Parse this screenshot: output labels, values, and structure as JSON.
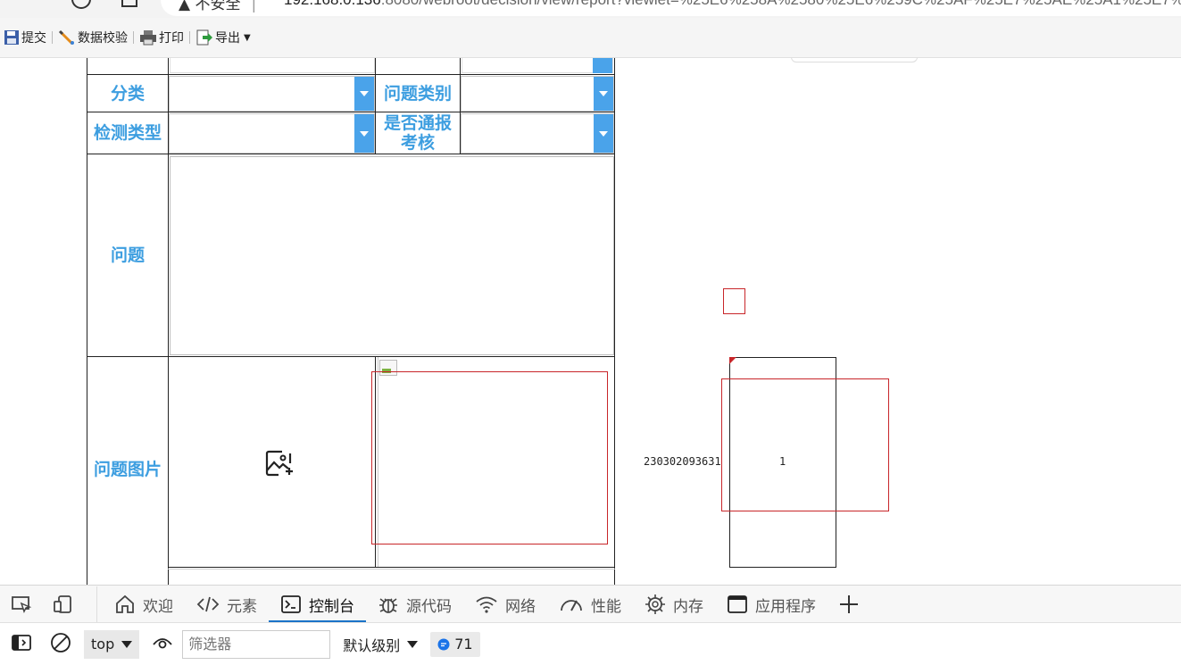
{
  "browser": {
    "security_label": "不安全",
    "url_host": "192.168.0.136",
    "url_rest": ":8080/webroot/decision/view/report?viewlet=%25E6%258A%2580%25E6%259C%25AF%25E7%25AE%25A1%25E7%2"
  },
  "toolbar": {
    "submit_label": "提交",
    "validate_label": "数据校验",
    "print_label": "打印",
    "export_label": "导出"
  },
  "form": {
    "category_label": "分类",
    "problem_type_label": "问题类别",
    "detection_type_label": "检测类型",
    "notify_assess_label_line1": "是否通报",
    "notify_assess_label_line2": "考核",
    "problem_label": "问题",
    "problem_image_label": "问题图片"
  },
  "side": {
    "record_id": "230302093631",
    "count": "1"
  },
  "devtools": {
    "tabs": [
      {
        "label": "欢迎",
        "icon": "home-icon"
      },
      {
        "label": "元素",
        "icon": "code-icon"
      },
      {
        "label": "控制台",
        "icon": "console-icon"
      },
      {
        "label": "源代码",
        "icon": "bug-icon"
      },
      {
        "label": "网络",
        "icon": "wifi-icon"
      },
      {
        "label": "性能",
        "icon": "gauge-icon"
      },
      {
        "label": "内存",
        "icon": "chip-icon"
      },
      {
        "label": "应用程序",
        "icon": "app-window-icon"
      }
    ],
    "active_tab": "控制台",
    "context": "top",
    "filter_placeholder": "筛选器",
    "level": "默认级别",
    "message_count": "71"
  }
}
